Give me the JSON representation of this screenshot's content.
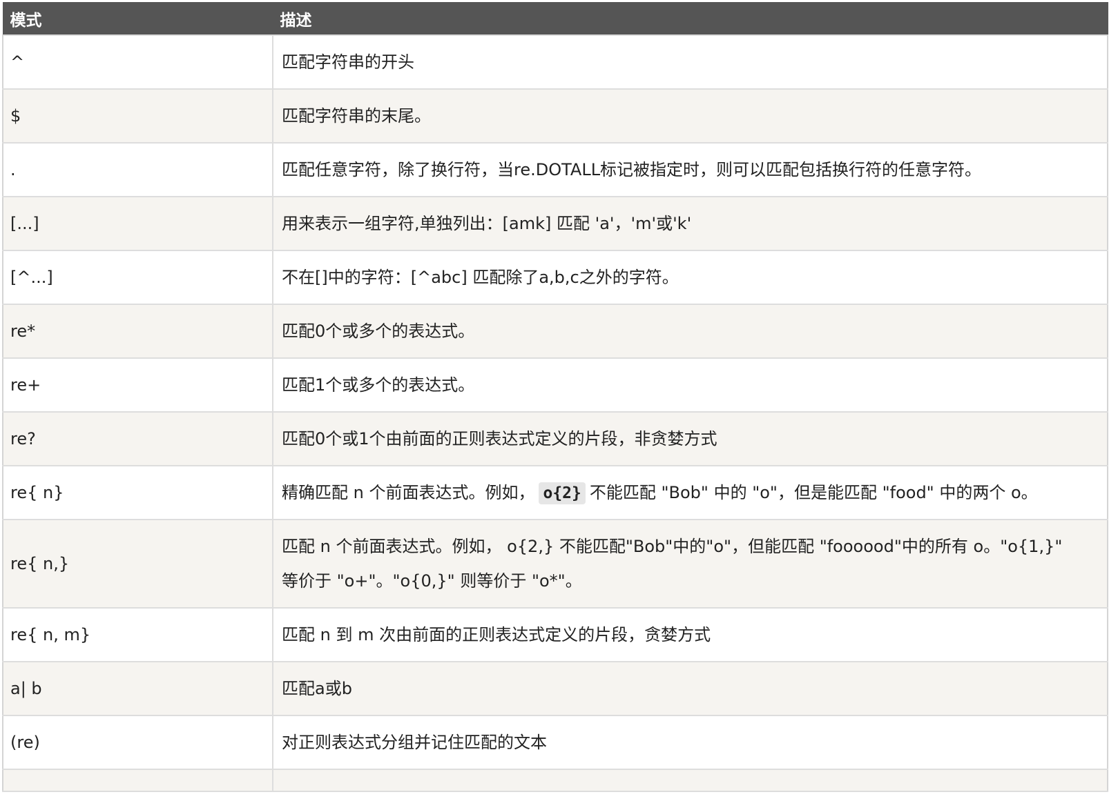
{
  "header": {
    "pattern": "模式",
    "description": "描述"
  },
  "rows": [
    {
      "pattern": "^",
      "description": "匹配字符串的开头"
    },
    {
      "pattern": "$",
      "description": "匹配字符串的末尾。"
    },
    {
      "pattern": ".",
      "description": "匹配任意字符，除了换行符，当re.DOTALL标记被指定时，则可以匹配包括换行符的任意字符。"
    },
    {
      "pattern": "[...]",
      "description": "用来表示一组字符,单独列出：[amk] 匹配 'a'，'m'或'k'"
    },
    {
      "pattern": "[^...]",
      "description": "不在[]中的字符：[^abc] 匹配除了a,b,c之外的字符。"
    },
    {
      "pattern": "re*",
      "description": "匹配0个或多个的表达式。"
    },
    {
      "pattern": "re+",
      "description": "匹配1个或多个的表达式。"
    },
    {
      "pattern": "re?",
      "description": "匹配0个或1个由前面的正则表达式定义的片段，非贪婪方式"
    },
    {
      "pattern": "re{ n}",
      "description_before": "精确匹配 n 个前面表达式。例如，",
      "description_code": "o{2}",
      "description_after": "不能匹配 \"Bob\" 中的 \"o\"，但是能匹配 \"food\" 中的两个 o。"
    },
    {
      "pattern": "re{ n,}",
      "description_line1": "匹配 n 个前面表达式。例如， o{2,} 不能匹配\"Bob\"中的\"o\"，但能匹配 \"foooood\"中的所有 o。\"o{1,}\"",
      "description_line2": "等价于 \"o+\"。\"o{0,}\" 则等价于 \"o*\"。"
    },
    {
      "pattern": "re{ n, m}",
      "description": "匹配 n 到 m 次由前面的正则表达式定义的片段，贪婪方式"
    },
    {
      "pattern": "a| b",
      "description": "匹配a或b"
    },
    {
      "pattern": "(re)",
      "description": "对正则表达式分组并记住匹配的文本"
    }
  ]
}
